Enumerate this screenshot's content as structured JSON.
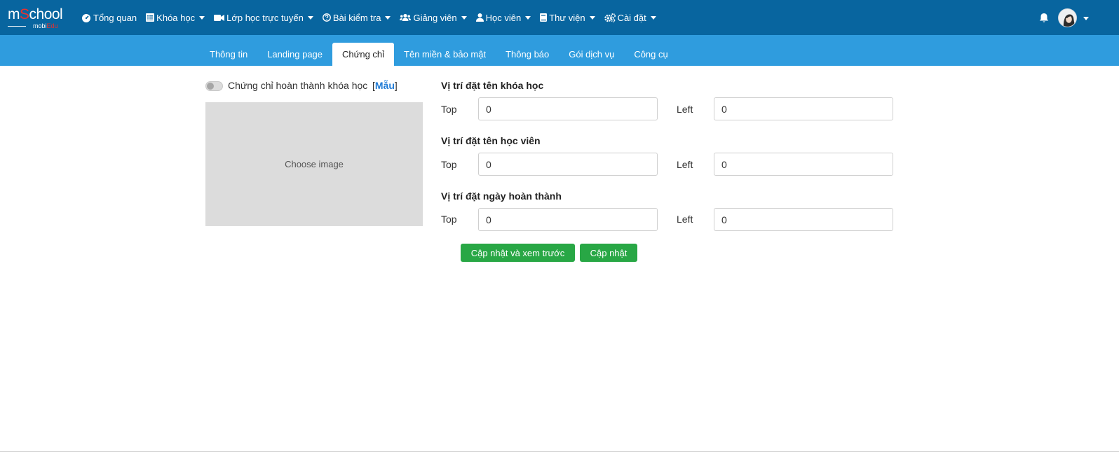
{
  "brand": {
    "logo_main_1": "m",
    "logo_main_o": "S",
    "logo_main_2": "chool",
    "logo_sub_1": "mobi",
    "logo_sub_2": "Edu"
  },
  "nav": {
    "items": [
      {
        "label": "Tổng quan",
        "icon": "dashboard-icon",
        "dropdown": false
      },
      {
        "label": "Khóa học",
        "icon": "list-icon",
        "dropdown": true
      },
      {
        "label": "Lớp học trực tuyến",
        "icon": "video-camera-icon",
        "dropdown": true
      },
      {
        "label": "Bài kiểm tra",
        "icon": "question-circle-icon",
        "dropdown": true
      },
      {
        "label": "Giảng viên",
        "icon": "users-icon",
        "dropdown": true
      },
      {
        "label": "Học viên",
        "icon": "user-icon",
        "dropdown": true
      },
      {
        "label": "Thư viện",
        "icon": "book-icon",
        "dropdown": true
      },
      {
        "label": "Cài đặt",
        "icon": "cogs-icon",
        "dropdown": true
      }
    ]
  },
  "tabs": [
    {
      "label": "Thông tin",
      "active": false
    },
    {
      "label": "Landing page",
      "active": false
    },
    {
      "label": "Chứng chỉ",
      "active": true
    },
    {
      "label": "Tên miền & bảo mật",
      "active": false
    },
    {
      "label": "Thông báo",
      "active": false
    },
    {
      "label": "Gói dịch vụ",
      "active": false
    },
    {
      "label": "Công cụ",
      "active": false
    }
  ],
  "certificate": {
    "toggle_label": "Chứng chỉ hoàn thành khóa học",
    "sample_open": "[",
    "sample_link": "Mẫu",
    "sample_close": "]",
    "image_placeholder": "Choose image"
  },
  "positions": [
    {
      "title": "Vị trí đặt tên khóa học",
      "top_label": "Top",
      "top_value": "0",
      "left_label": "Left",
      "left_value": "0"
    },
    {
      "title": "Vị trí đặt tên học viên",
      "top_label": "Top",
      "top_value": "0",
      "left_label": "Left",
      "left_value": "0"
    },
    {
      "title": "Vị trí đặt ngày hoàn thành",
      "top_label": "Top",
      "top_value": "0",
      "left_label": "Left",
      "left_value": "0"
    }
  ],
  "actions": {
    "update_preview_label": "Cập nhật và xem trước",
    "update_label": "Cập nhật"
  },
  "colors": {
    "navbar": "#08659f",
    "tabbar": "#2f9cde",
    "button": "#28a745",
    "link": "#1f7bd6"
  }
}
